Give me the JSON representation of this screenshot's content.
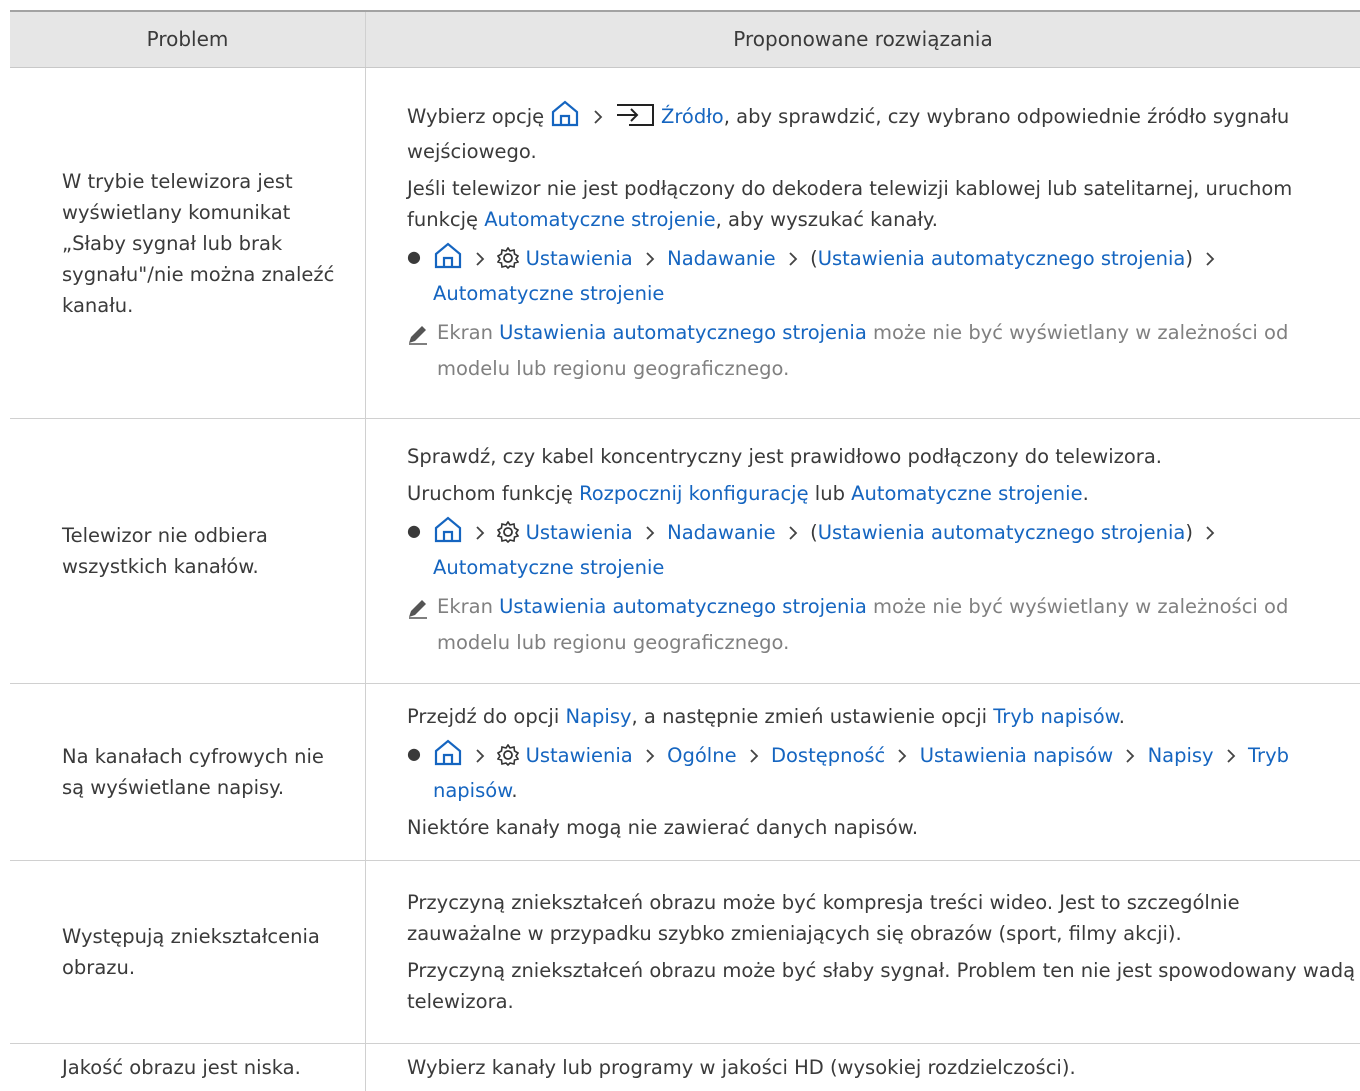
{
  "header": {
    "col1": "Problem",
    "col2": "Proponowane rozwiązania"
  },
  "sep": "›",
  "rows": [
    {
      "problem": "W trybie telewizora jest wyświetlany komunikat „Słaby sygnał lub brak sygnału\"/nie można znaleźć kanału.",
      "p1_a": "Wybierz opcję",
      "p1_link": "Źródło",
      "p1_b": ", aby sprawdzić, czy wybrano odpowiednie źródło sygnału wejściowego.",
      "p2_a": "Jeśli telewizor nie jest podłączony do dekodera telewizji kablowej lub satelitarnej, uruchom funkcję",
      "p2_link": "Automatyczne strojenie",
      "p2_b": ", aby wyszukać kanały.",
      "path": [
        "Ustawienia",
        "Nadawanie",
        "Ustawienia automatycznego strojenia",
        "Automatyczne strojenie"
      ],
      "note_a": "Ekran",
      "note_link": "Ustawienia automatycznego strojenia",
      "note_b": "może nie być wyświetlany w zależności od modelu lub regionu geograficznego."
    },
    {
      "problem": "Telewizor nie odbiera wszystkich kanałów.",
      "p1": "Sprawdź, czy kabel koncentryczny jest prawidłowo podłączony do telewizora.",
      "p2_a": "Uruchom funkcję",
      "p2_link1": "Rozpocznij konfigurację",
      "p2_mid": "lub",
      "p2_link2": "Automatyczne strojenie",
      "p2_end": ".",
      "path": [
        "Ustawienia",
        "Nadawanie",
        "Ustawienia automatycznego strojenia",
        "Automatyczne strojenie"
      ],
      "note_a": "Ekran",
      "note_link": "Ustawienia automatycznego strojenia",
      "note_b": "może nie być wyświetlany w zależności od modelu lub regionu geograficznego."
    },
    {
      "problem": "Na kanałach cyfrowych nie są wyświetlane napisy.",
      "p1_a": "Przejdź do opcji",
      "p1_link1": "Napisy",
      "p1_mid": ", a następnie zmień ustawienie opcji",
      "p1_link2": "Tryb napisów",
      "p1_end": ".",
      "path": [
        "Ustawienia",
        "Ogólne",
        "Dostępność",
        "Ustawienia napisów",
        "Napisy",
        "Tryb napisów"
      ],
      "path_end": ".",
      "p2": "Niektóre kanały mogą nie zawierać danych napisów."
    },
    {
      "problem": "Występują zniekształcenia obrazu.",
      "p1": "Przyczyną zniekształceń obrazu może być kompresja treści wideo. Jest to szczególnie zauważalne w przypadku szybko zmieniających się obrazów (sport, filmy akcji).",
      "p2": "Przyczyną zniekształceń obrazu może być słaby sygnał. Problem ten nie jest spowodowany wadą telewizora."
    },
    {
      "problem": "Jakość obrazu jest niska.",
      "p1": "Wybierz kanały lub programy w jakości HD (wysokiej rozdzielczości)."
    }
  ],
  "colors": {
    "link": "#1565c0",
    "header_bg": "#e6e6e6",
    "note_text": "#808080"
  },
  "icons": [
    "home-icon",
    "source-icon",
    "settings-gear-icon",
    "chevron-right-icon",
    "pencil-note-icon"
  ]
}
